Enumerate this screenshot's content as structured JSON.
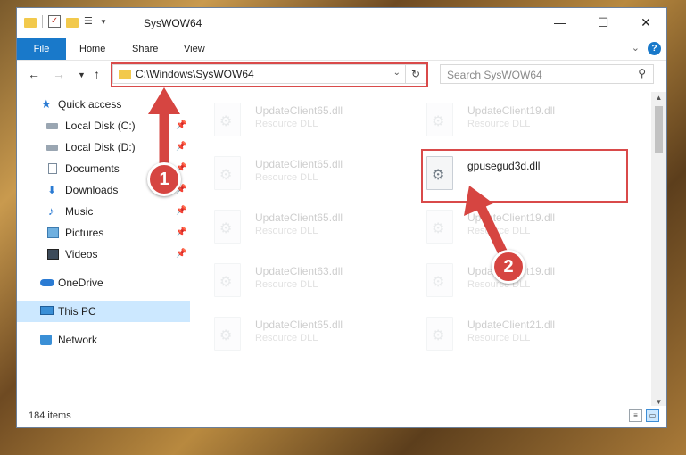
{
  "window": {
    "title": "SysWOW64",
    "controls": {
      "minimize": "—",
      "maximize": "☐",
      "close": "✕"
    }
  },
  "ribbon": {
    "tabs": [
      "File",
      "Home",
      "Share",
      "View"
    ],
    "help": "?"
  },
  "address": {
    "path": "C:\\Windows\\SysWOW64",
    "search_placeholder": "Search SysWOW64"
  },
  "nav_pane": {
    "items": [
      {
        "label": "Quick access",
        "icon": "star-icon"
      },
      {
        "label": "Local Disk (C:)",
        "icon": "drive-icon",
        "pinned": true
      },
      {
        "label": "Local Disk (D:)",
        "icon": "drive-icon",
        "pinned": true
      },
      {
        "label": "Documents",
        "icon": "documents-icon",
        "pinned": true
      },
      {
        "label": "Downloads",
        "icon": "downloads-icon",
        "pinned": true
      },
      {
        "label": "Music",
        "icon": "music-icon",
        "pinned": true
      },
      {
        "label": "Pictures",
        "icon": "pictures-icon",
        "pinned": true
      },
      {
        "label": "Videos",
        "icon": "videos-icon",
        "pinned": true
      },
      {
        "label": "OneDrive",
        "icon": "onedrive-icon"
      },
      {
        "label": "This PC",
        "icon": "this-pc-icon",
        "selected": true
      },
      {
        "label": "Network",
        "icon": "network-icon"
      }
    ]
  },
  "files": {
    "col1": [
      {
        "name": "UpdateClient65.dll",
        "type": "Resource DLL"
      },
      {
        "name": "UpdateClient65.dll",
        "type": "Resource DLL"
      },
      {
        "name": "UpdateClient65.dll",
        "type": "Resource DLL"
      },
      {
        "name": "UpdateClient63.dll",
        "type": "Resource DLL"
      },
      {
        "name": "UpdateClient65.dll",
        "type": "Resource DLL"
      }
    ],
    "col2": [
      {
        "name": "UpdateClient19.dll",
        "type": "Resource DLL"
      },
      {
        "name": "gpusegud3d.dll",
        "type": ""
      },
      {
        "name": "UpdateClient19.dll",
        "type": "Resource DLL"
      },
      {
        "name": "UpdateClient19.dll",
        "type": "Resource DLL"
      },
      {
        "name": "UpdateClient21.dll",
        "type": "Resource DLL"
      }
    ]
  },
  "status": {
    "item_count": "184 items"
  },
  "annotations": {
    "step1": "1",
    "step2": "2",
    "color": "#d64541"
  }
}
